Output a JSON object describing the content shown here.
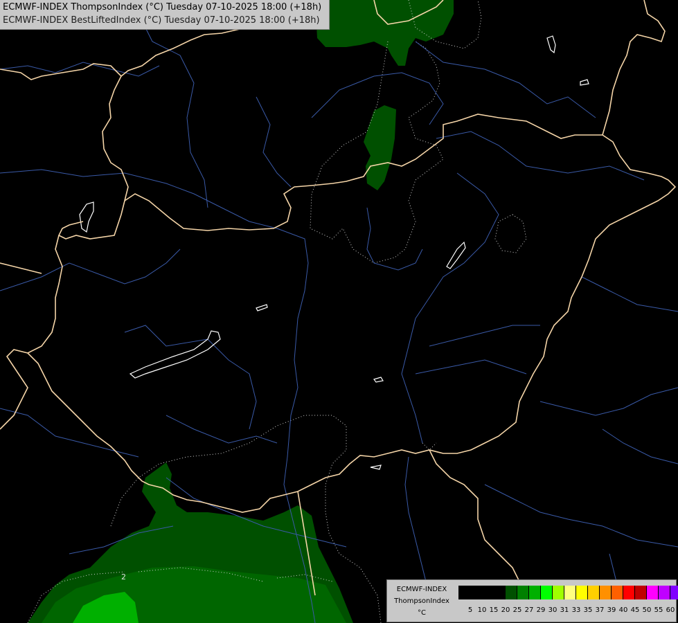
{
  "header": {
    "line1": "ECMWF-INDEX ThompsonIndex (°C) Tuesday 07-10-2025 18:00 (+18h)",
    "line2": "ECMWF-INDEX BestLiftedIndex (°C) Tuesday 07-10-2025 18:00 (+18h)"
  },
  "legend": {
    "title_model": "ECMWF-INDEX",
    "title_index": "ThompsonIndex",
    "title_unit": "°C",
    "colors": [
      "#000000",
      "#000000",
      "#000000",
      "#000000",
      "#005000",
      "#008000",
      "#00b000",
      "#00ff00",
      "#a0ff00",
      "#ffff80",
      "#ffff00",
      "#ffd000",
      "#ff9000",
      "#ff6000",
      "#ff0000",
      "#c00000",
      "#ff00ff",
      "#c000ff",
      "#8000ff",
      "#6040ff",
      "#0000ff"
    ],
    "ticks": [
      "5",
      "10",
      "15",
      "20",
      "25",
      "27",
      "29",
      "30",
      "31",
      "33",
      "35",
      "37",
      "39",
      "40",
      "45",
      "50",
      "55",
      "60"
    ]
  },
  "map": {
    "contour_label": "2",
    "field_colors": {
      "dark": "#005000",
      "mid": "#008000",
      "light": "#00b000"
    },
    "border_color": "#f5d5a8",
    "river_color": "#3a5aa8"
  }
}
